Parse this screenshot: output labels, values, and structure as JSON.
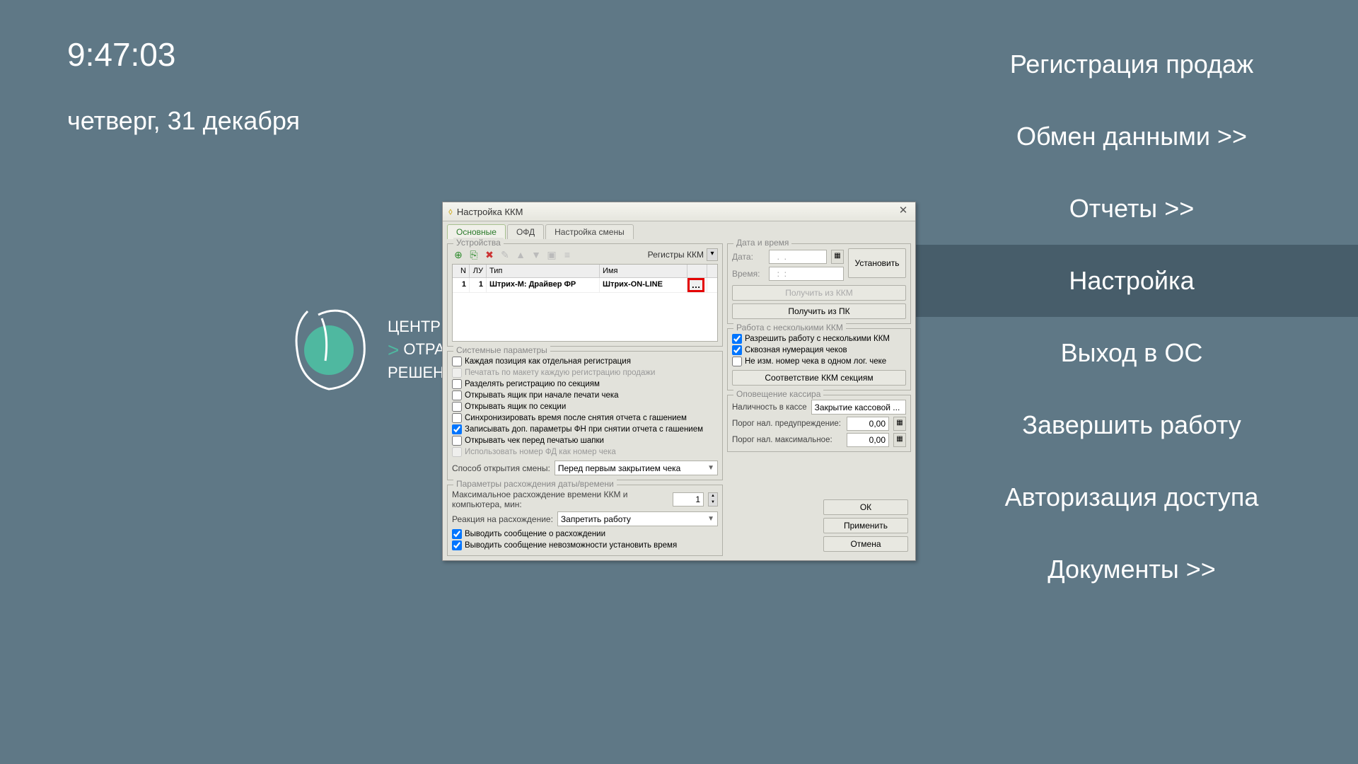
{
  "desktop": {
    "time": "9:47:03",
    "date": "четверг, 31 декабря",
    "logo_line1": "ЦЕНТР",
    "logo_line2": "ОТРАСЛЕВ",
    "logo_line3": "РЕШЕНИЙ"
  },
  "menu": {
    "items": [
      {
        "label": "Регистрация продаж",
        "active": false
      },
      {
        "label": "Обмен данными >>",
        "active": false
      },
      {
        "label": "Отчеты >>",
        "active": false
      },
      {
        "label": "Настройка",
        "active": true
      },
      {
        "label": "Выход в ОС",
        "active": false
      },
      {
        "label": "Завершить работу",
        "active": false
      },
      {
        "label": "Авторизация доступа",
        "active": false
      },
      {
        "label": "Документы >>",
        "active": false
      }
    ]
  },
  "dialog": {
    "title": "Настройка ККМ",
    "tabs": {
      "main": "Основные",
      "ofd": "ОФД",
      "shift": "Настройка смены"
    },
    "devices": {
      "title": "Устройства",
      "toolbar_label": "Регистры ККМ",
      "headers": {
        "n": "N",
        "lu": "ЛУ",
        "type": "Тип",
        "name": "Имя"
      },
      "row": {
        "n": "1",
        "lu": "1",
        "type": "Штрих-М: Драйвер ФР",
        "name": "Штрих-ON-LINE"
      }
    },
    "sysparams": {
      "title": "Системные параметры",
      "c1": "Каждая позиция как отдельная регистрация",
      "c2": "Печатать по макету каждую регистрацию продажи",
      "c3": "Разделять регистрацию по секциям",
      "c4": "Открывать ящик при начале печати чека",
      "c5": "Открывать ящик по секции",
      "c6": "Синхронизировать время после снятия отчета с гашением",
      "c7": "Записывать доп. параметры ФН при снятии отчета с гашением",
      "c8": "Открывать чек перед печатью шапки",
      "c9": "Использовать номер ФД как номер чека",
      "open_mode_label": "Способ открытия смены:",
      "open_mode_value": "Перед первым закрытием чека"
    },
    "timediff": {
      "title": "Параметры расхождения даты/времени",
      "max_label": "Максимальное расхождение времени ККМ и компьютера, мин:",
      "max_value": "1",
      "react_label": "Реакция на расхождение:",
      "react_value": "Запретить работу",
      "msg1": "Выводить сообщение о расхождении",
      "msg2": "Выводить сообщение невозможности установить время"
    },
    "datetime": {
      "title": "Дата и время",
      "date_label": "Дата:",
      "date_value": "  .  .",
      "time_label": "Время:",
      "time_value": "  :  :",
      "set_btn": "Установить",
      "get_kkm": "Получить из ККМ",
      "get_pc": "Получить из ПК"
    },
    "multi": {
      "title": "Работа с несколькими ККМ",
      "c1": "Разрешить работу с несколькими ККМ",
      "c2": "Сквозная нумерация чеков",
      "c3": "Не изм. номер чека в одном лог. чеке",
      "map_btn": "Соответствие ККМ секциям"
    },
    "alert": {
      "title": "Оповещение кассира",
      "cash_label": "Наличность в кассе",
      "cash_value": "Закрытие кассовой ...",
      "warn_label": "Порог нал. предупреждение:",
      "warn_value": "0,00",
      "max_label": "Порог нал. максимальное:",
      "max_value": "0,00"
    },
    "buttons": {
      "ok": "ОК",
      "apply": "Применить",
      "cancel": "Отмена"
    }
  }
}
